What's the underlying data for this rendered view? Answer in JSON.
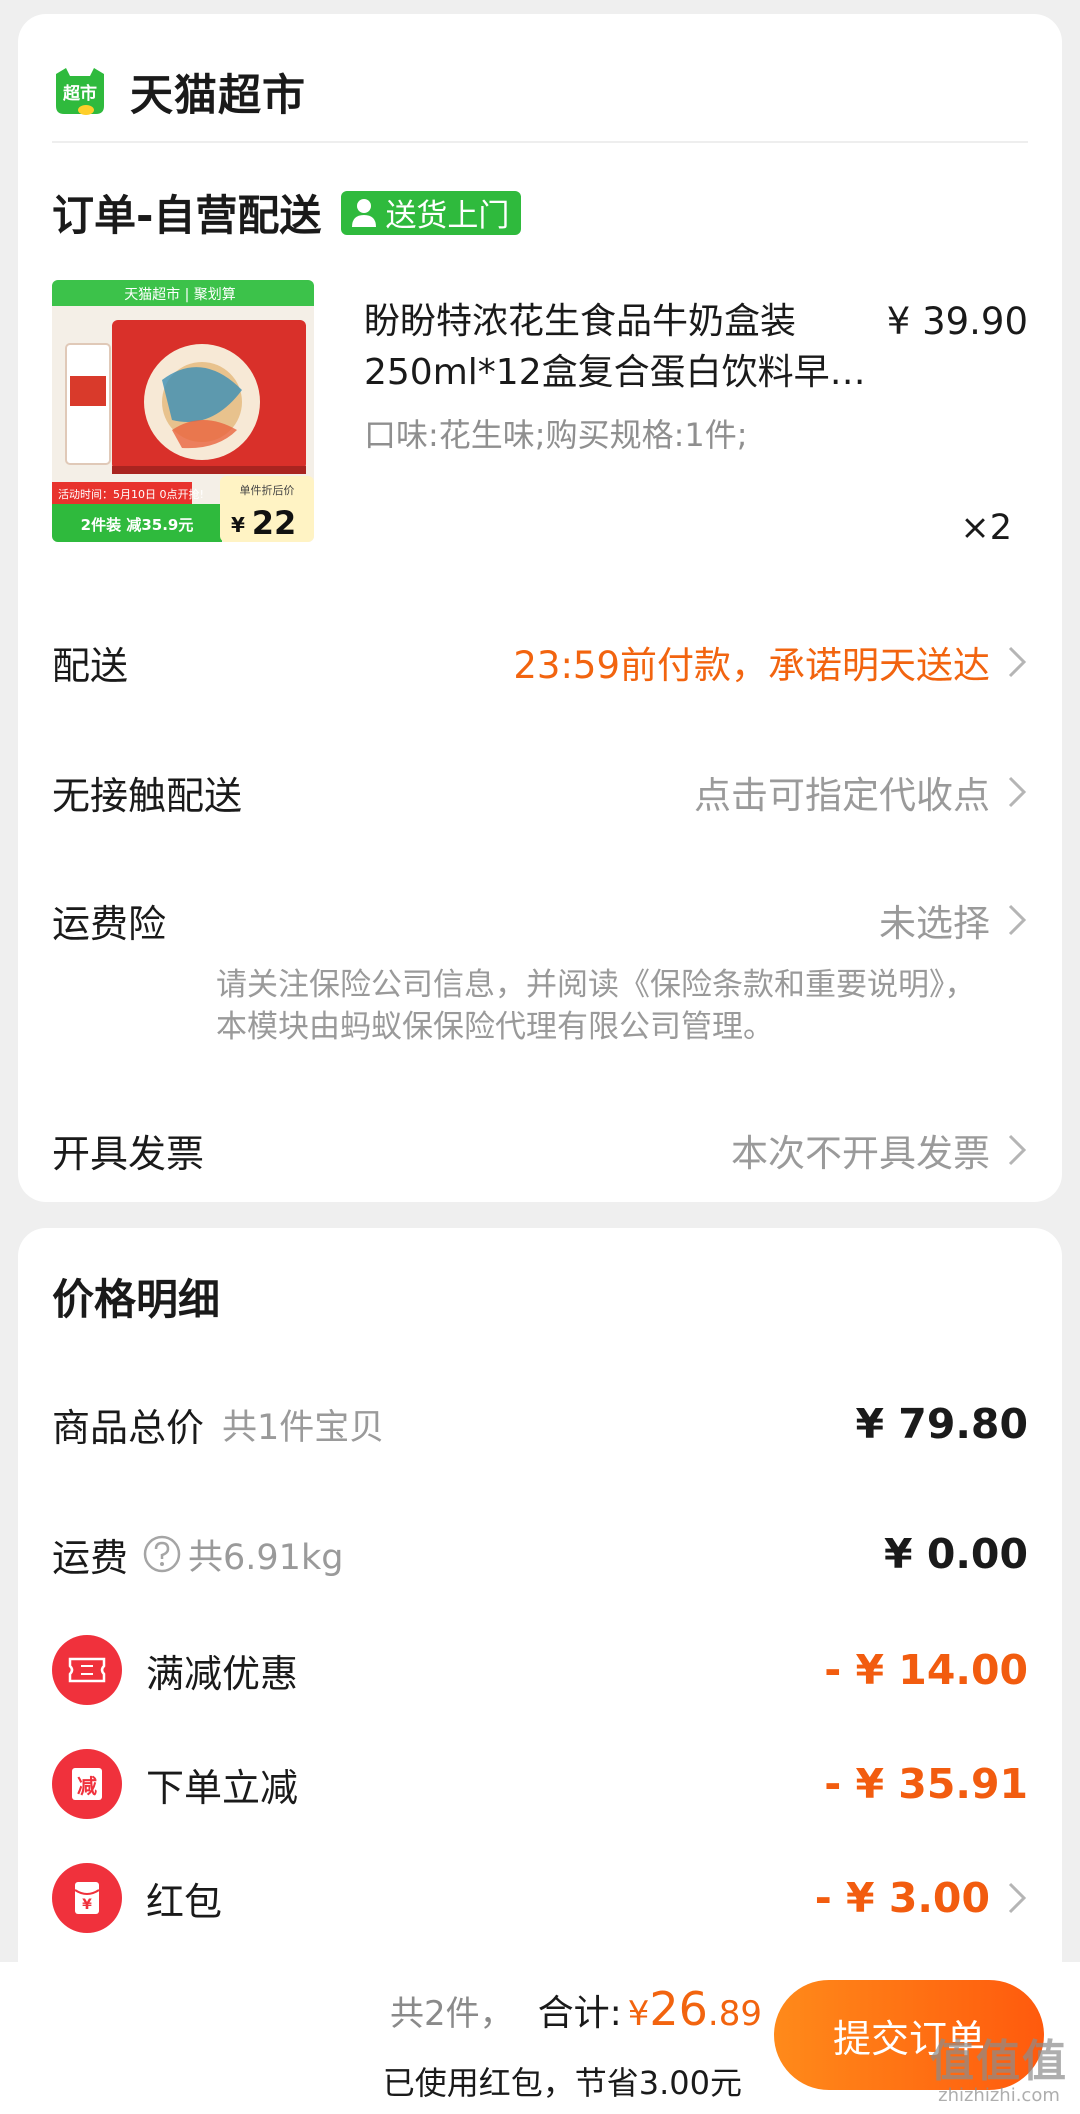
{
  "store": {
    "name": "天猫超市",
    "logo_text": "超市"
  },
  "order": {
    "title": "订单-自营配送",
    "delivery_badge": "送货上门"
  },
  "product": {
    "title": "盼盼特浓花生食品牛奶盒装250ml*12盒复合蛋白饮料早…",
    "price": "¥ 39.90",
    "spec": "口味:花生味;购买规格:1件;",
    "qty": "×2",
    "thumb": {
      "banner": "天猫超市 | 聚划算",
      "activity": "活动时间：5月10日 0点开抢!",
      "promo": "2件装 减35.9元",
      "unit_label": "单件折后价",
      "unit_price": "22",
      "unit_currency": "¥"
    }
  },
  "rows": {
    "delivery": {
      "label": "配送",
      "value": "23:59前付款，承诺明天送达"
    },
    "contactless": {
      "label": "无接触配送",
      "value": "点击可指定代收点"
    },
    "insurance": {
      "label": "运费险",
      "value": "未选择",
      "note": "请关注保险公司信息，并阅读《保险条款和重要说明》，本模块由蚂蚁保保险代理有限公司管理。"
    },
    "invoice": {
      "label": "开具发票",
      "value": "本次不开具发票"
    }
  },
  "price_detail": {
    "title": "价格明细",
    "goods": {
      "label": "商品总价",
      "sub": "共1件宝贝",
      "amount": "¥ 79.80"
    },
    "shipping": {
      "label": "运费",
      "sub": "共6.91kg",
      "amount": "¥ 0.00"
    },
    "full_reduction": {
      "label": "满减优惠",
      "amount": "- ¥ 14.00",
      "icon": "ticket-icon"
    },
    "instant_reduction": {
      "label": "下单立减",
      "amount": "- ¥ 35.91",
      "icon_text": "减"
    },
    "red_packet": {
      "label": "红包",
      "amount": "- ¥ 3.00",
      "icon_text": "¥"
    }
  },
  "bottom": {
    "count": "共2件，",
    "total_label": "合计:",
    "currency": "¥",
    "total_int": "26",
    "total_dec": ".89",
    "saved": "已使用红包，节省3.00元",
    "submit": "提交订单"
  },
  "watermark": {
    "main": "值值值",
    "sub": "zhizhizhi.com"
  },
  "colors": {
    "accent": "#f2640f",
    "green": "#2fba3d",
    "red": "#f0313c"
  }
}
